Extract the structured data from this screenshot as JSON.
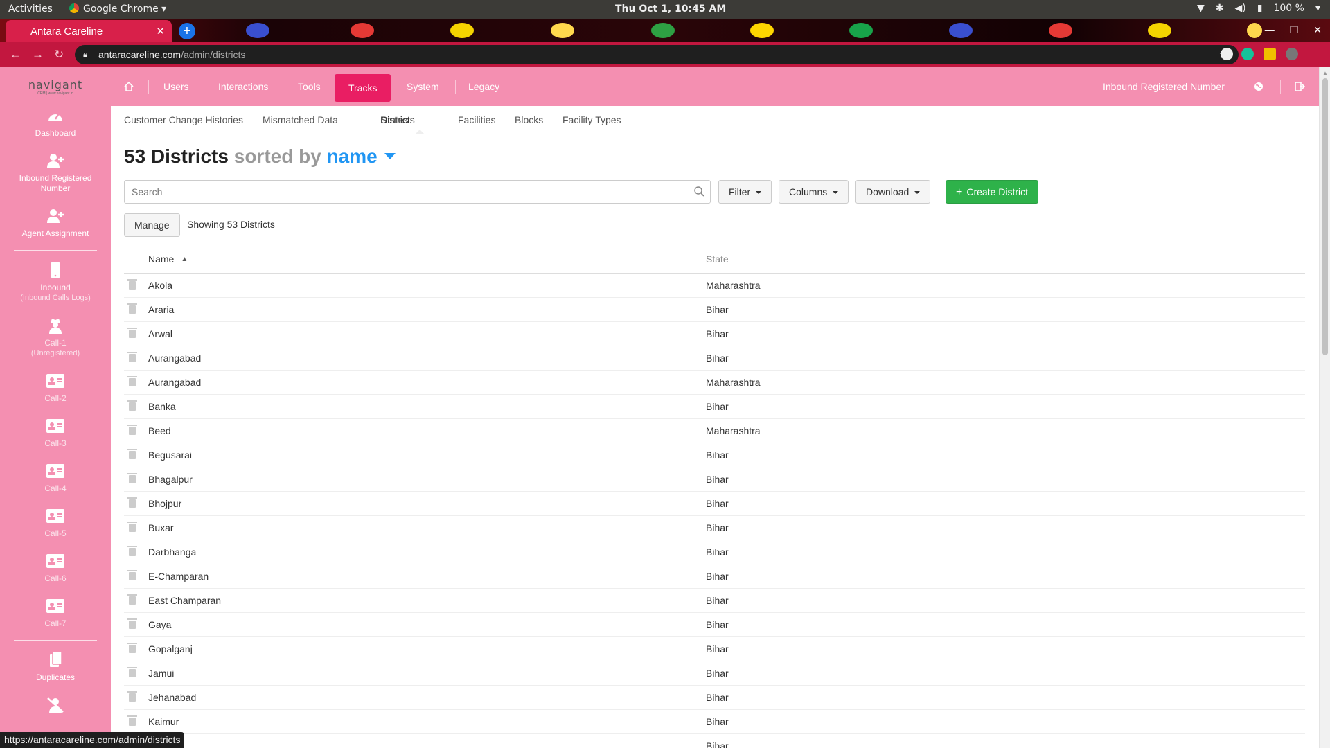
{
  "os": {
    "activities": "Activities",
    "app_name": "Google Chrome",
    "clock": "Thu Oct  1, 10:45 AM",
    "battery": "100 %"
  },
  "browser": {
    "tab_title": "Antara Careline",
    "url_host": "antaracareline.com",
    "url_path": "/admin/districts",
    "status_url": "https://antaracareline.com/admin/districts"
  },
  "sidebar": {
    "logo_text": "navigant",
    "logo_tagline": "CRM | www.navigant.in",
    "items": [
      {
        "label": "Dashboard",
        "sub": ""
      },
      {
        "label": "Inbound Registered Number",
        "sub": ""
      },
      {
        "label": "Agent Assignment",
        "sub": ""
      },
      {
        "label": "Inbound",
        "sub": "(Inbound Calls Logs)"
      },
      {
        "label": "Call-1",
        "sub": "(Unregistered)"
      },
      {
        "label": "Call-2",
        "sub": ""
      },
      {
        "label": "Call-3",
        "sub": ""
      },
      {
        "label": "Call-4",
        "sub": ""
      },
      {
        "label": "Call-5",
        "sub": ""
      },
      {
        "label": "Call-6",
        "sub": ""
      },
      {
        "label": "Call-7",
        "sub": ""
      },
      {
        "label": "Duplicates",
        "sub": ""
      }
    ]
  },
  "navbar": {
    "items": [
      "Users",
      "Interactions",
      "Tools",
      "Tracks",
      "System",
      "Legacy"
    ],
    "right_label": "Inbound Registered Number"
  },
  "subnav": {
    "items": [
      "Customer Change Histories",
      "Mismatched Data",
      "States",
      "Districts",
      "Facilities",
      "Blocks",
      "Facility Types"
    ]
  },
  "page": {
    "count_title": "53 Districts",
    "sorted_by": "sorted by",
    "sort_field": "name",
    "search_placeholder": "Search",
    "filter_label": "Filter",
    "columns_label": "Columns",
    "download_label": "Download",
    "create_label": "Create District",
    "manage_label": "Manage",
    "showing_text": "Showing 53 Districts"
  },
  "table": {
    "columns": [
      "Name",
      "State"
    ],
    "rows": [
      [
        "Akola",
        "Maharashtra"
      ],
      [
        "Araria",
        "Bihar"
      ],
      [
        "Arwal",
        "Bihar"
      ],
      [
        "Aurangabad",
        "Bihar"
      ],
      [
        "Aurangabad",
        "Maharashtra"
      ],
      [
        "Banka",
        "Bihar"
      ],
      [
        "Beed",
        "Maharashtra"
      ],
      [
        "Begusarai",
        "Bihar"
      ],
      [
        "Bhagalpur",
        "Bihar"
      ],
      [
        "Bhojpur",
        "Bihar"
      ],
      [
        "Buxar",
        "Bihar"
      ],
      [
        "Darbhanga",
        "Bihar"
      ],
      [
        "E-Champaran",
        "Bihar"
      ],
      [
        "East Champaran",
        "Bihar"
      ],
      [
        "Gaya",
        "Bihar"
      ],
      [
        "Gopalganj",
        "Bihar"
      ],
      [
        "Jamui",
        "Bihar"
      ],
      [
        "Jehanabad",
        "Bihar"
      ],
      [
        "Kaimur",
        "Bihar"
      ],
      [
        "",
        "Bihar"
      ]
    ]
  },
  "colors": {
    "sidebar_bg": "#f48fb1",
    "nav_active": "#e91e63",
    "create_button": "#2eb24a",
    "link_blue": "#2196f3"
  }
}
